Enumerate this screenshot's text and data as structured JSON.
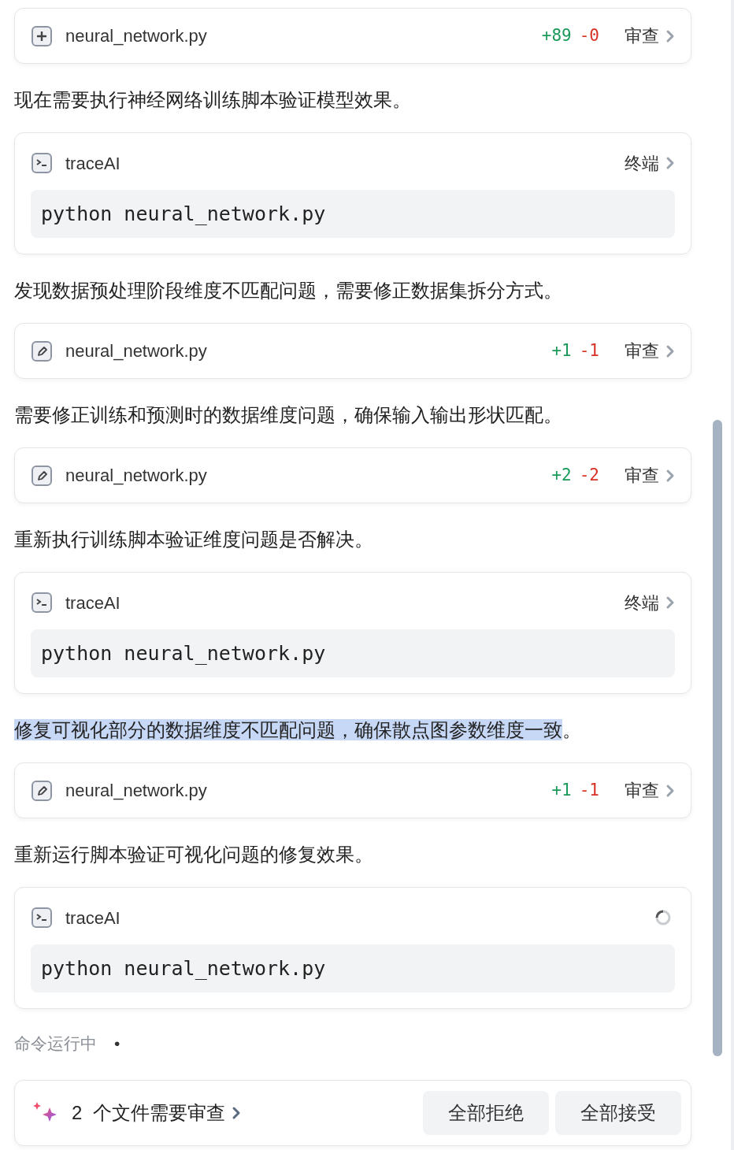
{
  "entries": [
    {
      "kind": "new_file",
      "name": "neural_network.py",
      "added": "+89",
      "removed": "-0",
      "review": "审查"
    },
    {
      "kind": "message",
      "text": "现在需要执行神经网络训练脚本验证模型效果。",
      "highlighted": false
    },
    {
      "kind": "terminal",
      "title": "traceAI",
      "command": "python neural_network.py",
      "running": false,
      "link": "终端"
    },
    {
      "kind": "message",
      "text": "发现数据预处理阶段维度不匹配问题，需要修正数据集拆分方式。",
      "highlighted": false
    },
    {
      "kind": "edited_file",
      "name": "neural_network.py",
      "added": "+1",
      "removed": "-1",
      "review": "审查"
    },
    {
      "kind": "message",
      "text": "需要修正训练和预测时的数据维度问题，确保输入输出形状匹配。",
      "highlighted": false
    },
    {
      "kind": "edited_file",
      "name": "neural_network.py",
      "added": "+2",
      "removed": "-2",
      "review": "审查"
    },
    {
      "kind": "message",
      "text": "重新执行训练脚本验证维度问题是否解决。",
      "highlighted": false
    },
    {
      "kind": "terminal",
      "title": "traceAI",
      "command": "python neural_network.py",
      "running": false,
      "link": "终端"
    },
    {
      "kind": "message",
      "text": "修复可视化部分的数据维度不匹配问题，确保散点图参数维度一致",
      "highlighted": true,
      "tail": "。"
    },
    {
      "kind": "edited_file",
      "name": "neural_network.py",
      "added": "+1",
      "removed": "-1",
      "review": "审查"
    },
    {
      "kind": "message",
      "text": "重新运行脚本验证可视化问题的修复效果。",
      "highlighted": false
    },
    {
      "kind": "terminal",
      "title": "traceAI",
      "command": "python neural_network.py",
      "running": true
    }
  ],
  "status": {
    "text": "命令运行中",
    "dot": "•"
  },
  "footer": {
    "count": "2",
    "label": "个文件需要审查",
    "buttons": [
      "全部拒绝",
      "全部接受"
    ]
  }
}
